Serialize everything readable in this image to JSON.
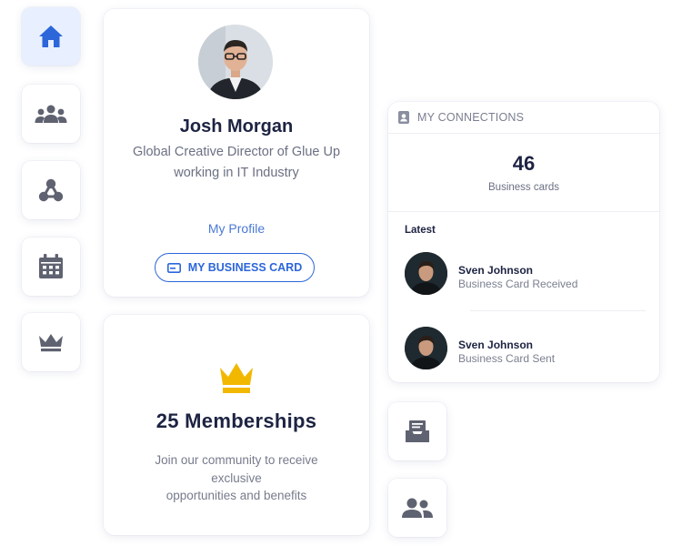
{
  "nav": {
    "items": [
      {
        "name": "home",
        "icon": "home-icon",
        "active": true
      },
      {
        "name": "groups",
        "icon": "group-icon",
        "active": false
      },
      {
        "name": "network",
        "icon": "network-icon",
        "active": false
      },
      {
        "name": "calendar",
        "icon": "calendar-icon",
        "active": false
      },
      {
        "name": "membership",
        "icon": "crown-icon",
        "active": false
      }
    ]
  },
  "profile": {
    "name": "Josh Morgan",
    "title": "Global Creative Director of Glue Up working in IT Industry",
    "profile_link": "My Profile",
    "business_card_button": "MY BUSINESS CARD"
  },
  "membership": {
    "title": "25 Memberships",
    "description_line1": "Join our community to receive",
    "description_line2": "exclusive",
    "description_line3": "opportunities and benefits"
  },
  "connections": {
    "header": "MY CONNECTIONS",
    "count": "46",
    "count_label": "Business cards",
    "latest_label": "Latest",
    "items": [
      {
        "name": "Sven Johnson",
        "status": "Business Card Received"
      },
      {
        "name": "Sven Johnson",
        "status": "Business Card Sent"
      }
    ]
  },
  "quick_actions": [
    {
      "icon": "inbox-icon"
    },
    {
      "icon": "contacts-icon"
    }
  ],
  "colors": {
    "accent": "#2c66d9",
    "active_nav_bg": "#e8efff",
    "gold": "#f2b800",
    "icon_gray": "#5f6270",
    "heading": "#1d2342"
  }
}
